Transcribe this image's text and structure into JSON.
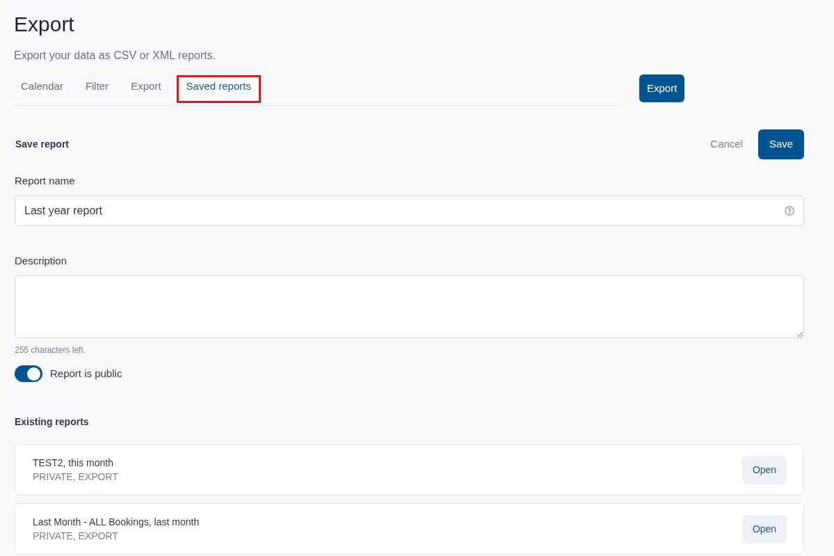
{
  "header": {
    "title": "Export",
    "subtitle": "Export your data as CSV or XML reports."
  },
  "tabs": [
    {
      "label": "Calendar",
      "selected": false,
      "highlighted": false
    },
    {
      "label": "Filter",
      "selected": false,
      "highlighted": false
    },
    {
      "label": "Export",
      "selected": false,
      "highlighted": false
    },
    {
      "label": "Saved reports",
      "selected": true,
      "highlighted": true
    }
  ],
  "export_button": "Export",
  "save_report": {
    "title": "Save report",
    "cancel": "Cancel",
    "save": "Save",
    "name_label": "Report name",
    "name_value": "Last year report",
    "description_label": "Description",
    "counter": "255 characters left.",
    "public": {
      "label": "Report is public",
      "on": true
    }
  },
  "existing_reports": {
    "title": "Existing reports",
    "items": [
      {
        "name": "TEST2, this month",
        "tags": "PRIVATE, EXPORT",
        "action": "Open"
      },
      {
        "name": "Last Month - ALL Bookings, last month",
        "tags": "PRIVATE, EXPORT",
        "action": "Open"
      }
    ]
  }
}
